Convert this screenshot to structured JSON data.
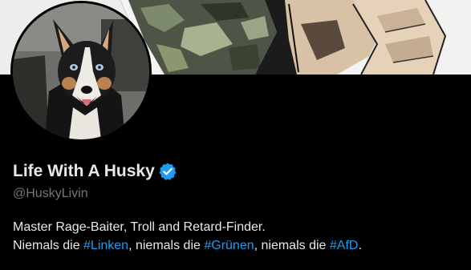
{
  "profile": {
    "display_name": "Life With A Husky",
    "handle": "@HuskyLivin",
    "verified": true,
    "verified_icon": "verified-badge-icon",
    "bio": {
      "line1": "Master Rage-Baiter, Troll and Retard-Finder.",
      "line2": {
        "part1": "Niemals die ",
        "tag1": "#Linken",
        "part2": ", niemals die ",
        "tag2": "#Grünen",
        "part3": ", niemals die ",
        "tag3": "#AfD",
        "part4": "."
      }
    }
  },
  "colors": {
    "background": "#000000",
    "text_primary": "#e7e9ea",
    "text_secondary": "#71767b",
    "link": "#1d9bf0",
    "verified": "#1d9bf0"
  }
}
